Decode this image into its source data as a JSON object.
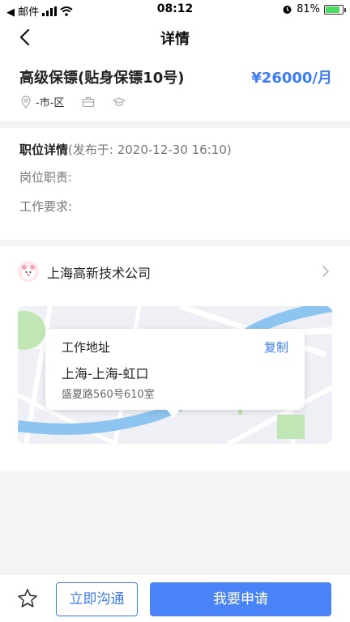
{
  "status_bar": {
    "back_app": "◀ 邮件",
    "time": "08:12",
    "battery": "81%"
  },
  "nav": {
    "title": "详情"
  },
  "job": {
    "title": "高级保镖(贴身保镖10号)",
    "salary": "¥26000/月",
    "location": "-市-区"
  },
  "details": {
    "heading": "职位详情",
    "published": "(发布于: 2020-12-30 16:10)",
    "duties_label": "岗位职责:",
    "requirements_label": "工作要求:"
  },
  "company": {
    "name": "上海高新技术公司"
  },
  "map_popup": {
    "label": "工作地址",
    "copy": "复制",
    "city": "上海-上海-虹口",
    "street": "盛夏路560号610室"
  },
  "bottom": {
    "chat_label": "立即沟通",
    "apply_label": "我要申请"
  },
  "colors": {
    "accent": "#3d7bf5",
    "button_blue": "#4a82f7"
  }
}
